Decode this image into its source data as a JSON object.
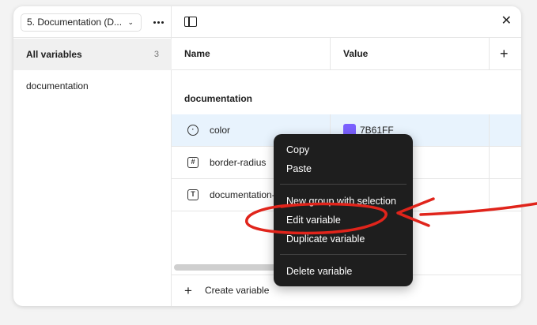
{
  "sidebar": {
    "collection_label": "5. Documentation (D...",
    "items": [
      {
        "label": "All variables",
        "count": "3"
      },
      {
        "label": "documentation"
      }
    ]
  },
  "table": {
    "columns": [
      "Name",
      "Value"
    ],
    "group_title": "documentation",
    "rows": [
      {
        "name": "color",
        "value": "7B61FF",
        "icon": "palette-icon"
      },
      {
        "name": "border-radius",
        "icon": "number-icon"
      },
      {
        "name": "documentation-",
        "icon": "text-icon"
      }
    ]
  },
  "footer": {
    "create_label": "Create variable"
  },
  "context_menu": {
    "items": [
      "Copy",
      "Paste",
      "New group with selection",
      "Edit variable",
      "Duplicate variable",
      "Delete variable"
    ]
  },
  "colors": {
    "swatch": "#7B61FF",
    "annotation": "#e0241b",
    "menu_bg": "#1e1e1e",
    "selected_row": "#e8f3fd"
  }
}
